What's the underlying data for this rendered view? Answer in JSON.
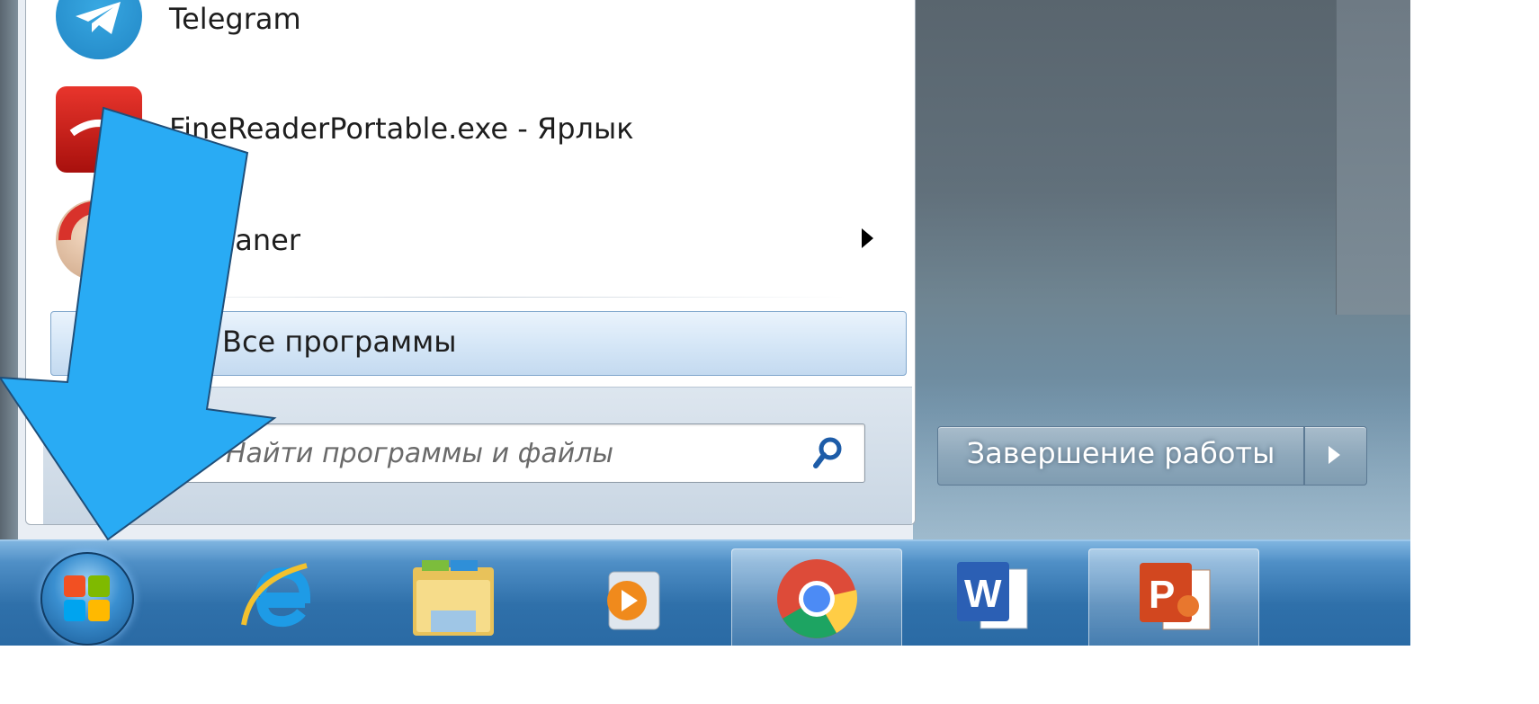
{
  "start_menu": {
    "programs": [
      {
        "label": "Telegram",
        "icon": "telegram-icon"
      },
      {
        "label": "FineReaderPortable.exe - Ярлык",
        "icon": "finereader-icon"
      },
      {
        "label": "CCleaner",
        "icon": "ccleaner-icon",
        "has_submenu": true
      }
    ],
    "all_programs_label": "Все программы",
    "search": {
      "placeholder": "Найти программы и файлы"
    },
    "shutdown_label": "Завершение работы"
  },
  "taskbar": {
    "items": [
      {
        "name": "start-button",
        "icon": "windows-orb-icon"
      },
      {
        "name": "internet-explorer",
        "icon": "internet-explorer-icon"
      },
      {
        "name": "windows-explorer",
        "icon": "folder-icon"
      },
      {
        "name": "media-player",
        "icon": "media-player-icon"
      },
      {
        "name": "google-chrome",
        "icon": "chrome-icon",
        "active": true
      },
      {
        "name": "microsoft-word",
        "icon": "word-icon"
      },
      {
        "name": "microsoft-powerpoint",
        "icon": "powerpoint-icon",
        "active": true
      }
    ]
  },
  "colors": {
    "arrow": "#29abf4",
    "taskbar": "#2f70aa",
    "highlight": "#d6e7f7"
  }
}
